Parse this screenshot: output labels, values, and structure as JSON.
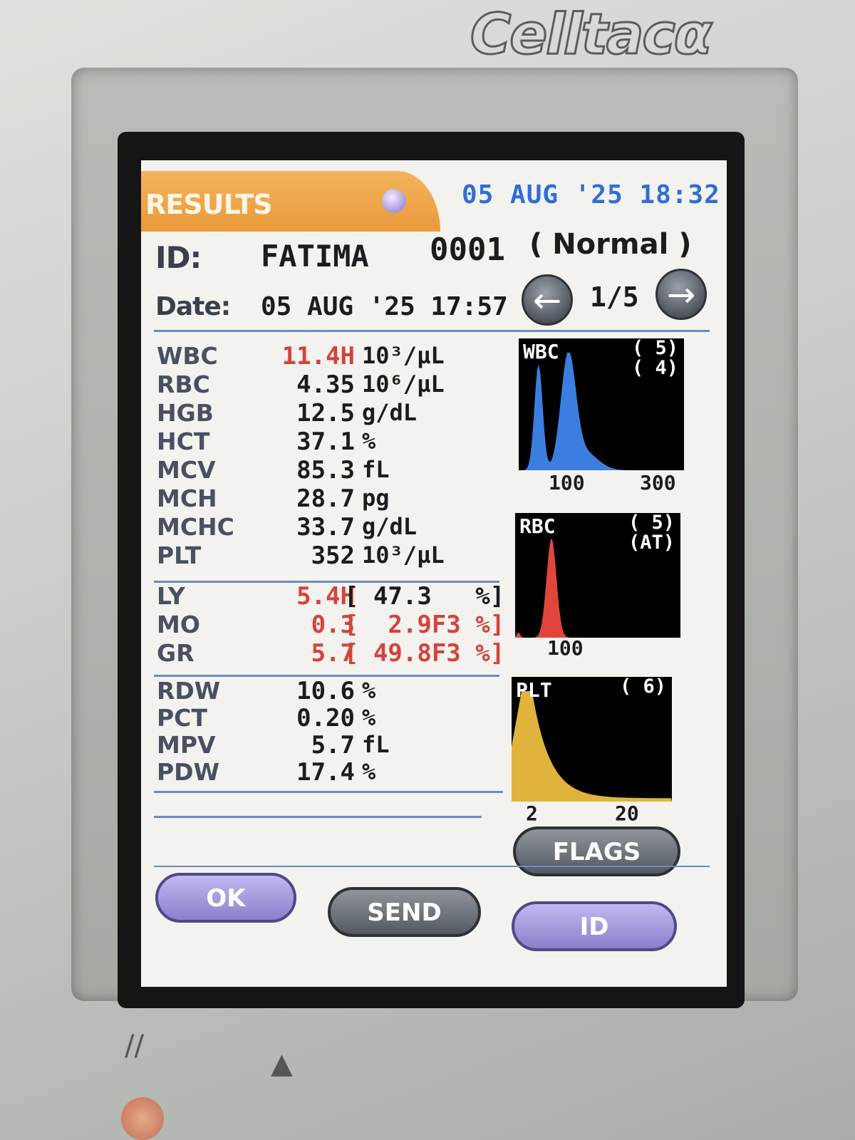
{
  "device": {
    "brand": "Celltacα"
  },
  "header": {
    "title": "RESULTS",
    "datetime": "05 AUG '25 18:32"
  },
  "sample": {
    "id_label": "ID:",
    "id_name": "FATIMA",
    "id_number": "0001",
    "mode": "( Normal )",
    "date_label": "Date:",
    "date_value": "05 AUG '25 17:57",
    "page": "1/5"
  },
  "params_main": [
    {
      "name": "WBC",
      "value": "11.4H",
      "unit": "10³/µL",
      "flag": true
    },
    {
      "name": "RBC",
      "value": "4.35",
      "unit": "10⁶/µL",
      "flag": false
    },
    {
      "name": "HGB",
      "value": "12.5",
      "unit": "g/dL",
      "flag": false
    },
    {
      "name": "HCT",
      "value": "37.1",
      "unit": "%",
      "flag": false
    },
    {
      "name": "MCV",
      "value": "85.3",
      "unit": "fL",
      "flag": false
    },
    {
      "name": "MCH",
      "value": "28.7",
      "unit": "pg",
      "flag": false
    },
    {
      "name": "MCHC",
      "value": "33.7",
      "unit": "g/dL",
      "flag": false
    },
    {
      "name": "PLT",
      "value": "352",
      "unit": "10³/µL",
      "flag": false
    }
  ],
  "params_diff": [
    {
      "name": "LY",
      "value": "5.4H",
      "pct": "[ 47.3   %]",
      "pct_flag": false
    },
    {
      "name": "MO",
      "value": "0.3",
      "pct": "[  2.9F3 %]",
      "pct_flag": true
    },
    {
      "name": "GR",
      "value": "5.7",
      "pct": "[ 49.8F3 %]",
      "pct_flag": true
    }
  ],
  "params_extra": [
    {
      "name": "RDW",
      "value": "10.6",
      "unit": "%"
    },
    {
      "name": "PCT",
      "value": "0.20",
      "unit": "%"
    },
    {
      "name": "MPV",
      "value": "5.7",
      "unit": "fL"
    },
    {
      "name": "PDW",
      "value": "17.4",
      "unit": "%"
    }
  ],
  "histograms": {
    "wbc": {
      "title": "WBC",
      "code": "( 5)\n( 4)",
      "ticks": [
        "100",
        "300"
      ],
      "color": "#3c7ee0"
    },
    "rbc": {
      "title": "RBC",
      "code": "( 5)\n(AT)",
      "ticks": [
        "100"
      ],
      "color": "#e0463c"
    },
    "plt": {
      "title": "PLT",
      "code": "( 6)",
      "ticks": [
        "2",
        "20"
      ],
      "color": "#e0b43c"
    }
  },
  "buttons": {
    "flags": "FLAGS",
    "ok": "OK",
    "send": "SEND",
    "id": "ID"
  },
  "colors": {
    "flag_red": "#d4433d",
    "header_blue": "#2f6fd3",
    "header_orange": "#e99a3a"
  }
}
